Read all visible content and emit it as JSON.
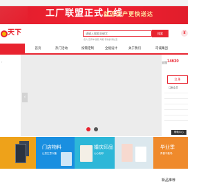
{
  "topbar": {
    "items": [
      "",
      "",
      ""
    ]
  },
  "banner": {
    "headline": "工厂联盟正式上线",
    "sub": "就近生产更快送达"
  },
  "logo": {
    "text": "天下",
    "tag": ""
  },
  "search": {
    "placeholder": "请输入搜索关键字",
    "button": "搜索",
    "hot_words": "名片  宣传单  画册  海报  手提袋  易拉宝"
  },
  "nav": {
    "items": [
      "首页",
      "热门活动",
      "按需定制",
      "全能设计",
      "关于我们",
      "司诚集团"
    ]
  },
  "right_panel": {
    "phone_label": "全国",
    "phone": "14630",
    "login_button": "注 册",
    "link": "注册会员",
    "more_button": "帮助中心"
  },
  "tiles": [
    {
      "title": "",
      "desc": ""
    },
    {
      "title": "门店物料",
      "desc": "让您生意兴隆"
    },
    {
      "title": "婚庆印品",
      "desc": "心心相印"
    },
    {
      "title": "",
      "desc": ""
    },
    {
      "title": "毕业季",
      "desc": "青春不散场"
    }
  ],
  "footer": {
    "new_products": "新品推荐"
  },
  "colors": {
    "brand_red": "#e8232f",
    "tile_orange": "#eea21a",
    "tile_blue": "#1a8fe0",
    "tile_cyan": "#2db7d8",
    "tile_light": "#dce8ee",
    "tile_orange2": "#ef8a2c"
  }
}
